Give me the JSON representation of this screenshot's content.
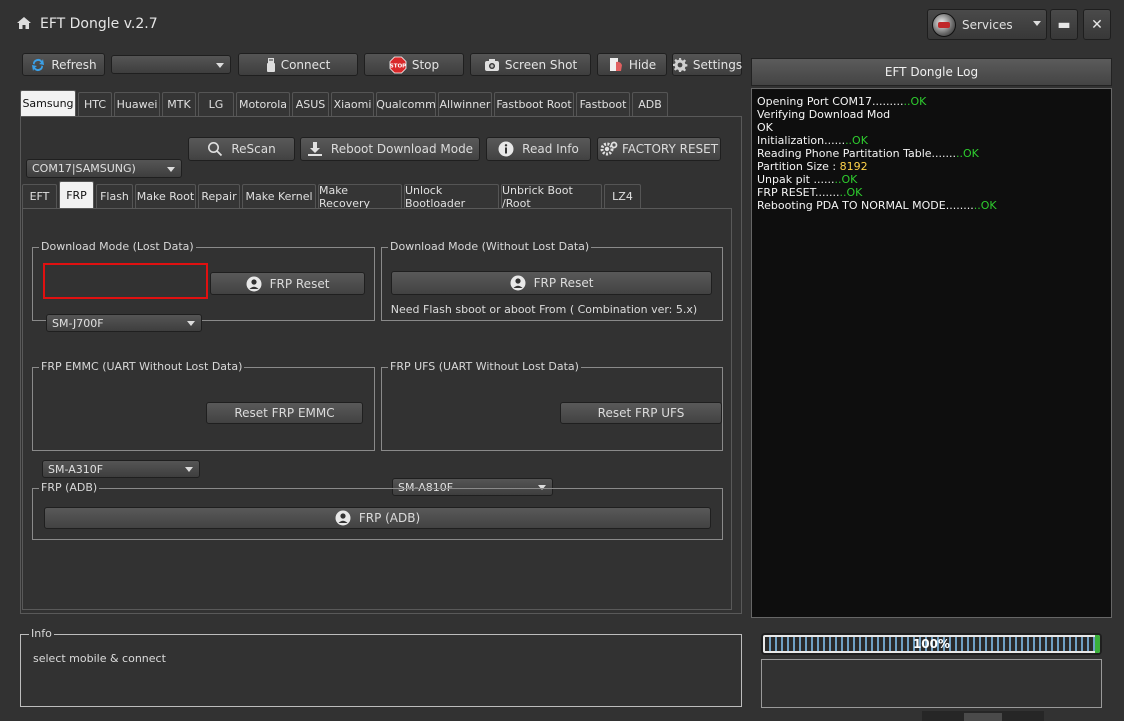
{
  "app": {
    "title": "EFT Dongle  v.2.7",
    "services_label": "Services",
    "minimize": "▬",
    "close": "✕"
  },
  "toolbar": {
    "refresh": "Refresh",
    "port_combo": "",
    "connect": "Connect",
    "stop": "Stop",
    "stop_icon_text": "STOP",
    "screenshot": "Screen Shot",
    "hide": "Hide",
    "settings": "Settings"
  },
  "brand_tabs": [
    "Samsung",
    "HTC",
    "Huawei",
    "MTK",
    "LG",
    "Motorola",
    "ASUS",
    "Xiaomi",
    "Qualcomm",
    "Allwinner",
    "Fastboot Root",
    "Fastboot",
    "ADB"
  ],
  "active_brand_tab": "Samsung",
  "device_bar": {
    "port_value": "COM17|SAMSUNG)",
    "rescan": "ReScan",
    "reboot_download": "Reboot  Download Mode",
    "read_info": "Read Info",
    "factory_reset": "FACTORY RESET"
  },
  "sub_tabs": [
    "EFT",
    "FRP",
    "Flash",
    "Make Root",
    "Repair",
    "Make Kernel",
    "Make Recovery",
    "Unlock Bootloader",
    "Unbrick Boot /Root",
    "LZ4"
  ],
  "active_sub_tab": "FRP",
  "frp": {
    "lost_data": {
      "title": "Download Mode (Lost Data)",
      "model": "SM-J700F",
      "button": "FRP Reset"
    },
    "no_lost_data": {
      "title": "Download Mode (Without Lost Data)",
      "button": "FRP Reset",
      "note": "Need Flash sboot  or aboot From ( Combination ver: 5.x)"
    },
    "emmc": {
      "title": "FRP EMMC (UART Without Lost Data)",
      "model": "SM-A310F",
      "button": "Reset FRP EMMC"
    },
    "ufs": {
      "title": "FRP UFS (UART Without Lost Data)",
      "model": "SM-A810F",
      "button": "Reset FRP UFS"
    },
    "adb": {
      "title": "FRP (ADB)",
      "button": "FRP (ADB)"
    }
  },
  "info": {
    "title": "Info",
    "text": "select mobile & connect"
  },
  "log": {
    "title": "EFT Dongle Log",
    "lines": [
      {
        "text": "Opening Port COM17.........",
        "status": "..OK"
      },
      {
        "text": "Verifying Download Mod",
        "status": ""
      },
      {
        "text": "OK",
        "status": ""
      },
      {
        "text": "Initialization......",
        "status": "..OK"
      },
      {
        "text": "Reading Phone Partitation Table.......",
        "status": "..OK"
      },
      {
        "text": "Partition Size : ",
        "value": "8192"
      },
      {
        "text": "Unpak pit ......",
        "status": "..OK"
      },
      {
        "text": "FRP RESET.......",
        "status": "..OK"
      },
      {
        "text": "Rebooting PDA TO NORMAL MODE........",
        "status": "..OK"
      }
    ]
  },
  "progress": {
    "percent": 100,
    "label": "100%"
  },
  "colors": {
    "ok": "#2ecc2e",
    "highlight_box": "#e01010",
    "background": "#323232"
  }
}
